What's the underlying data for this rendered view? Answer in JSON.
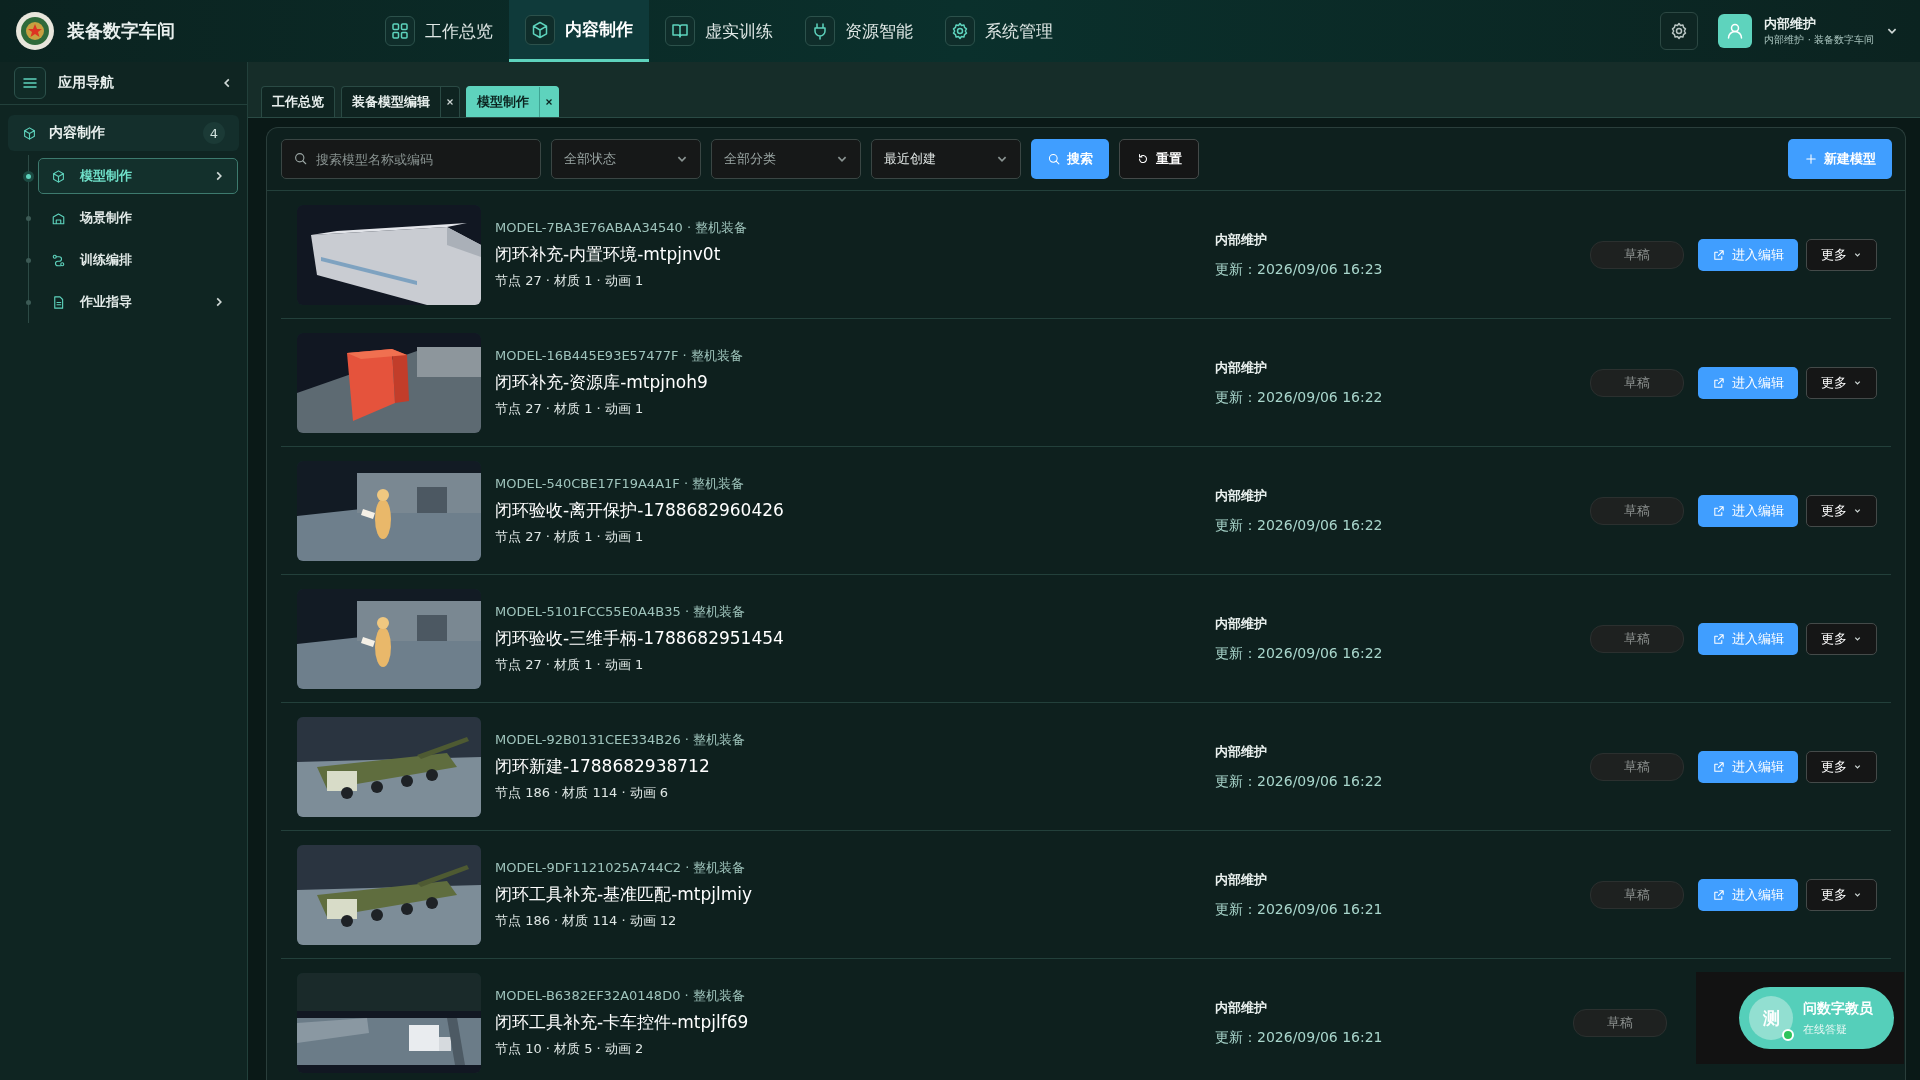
{
  "app": {
    "title": "装备数字车间"
  },
  "top_nav": [
    {
      "label": "工作总览",
      "selected": false
    },
    {
      "label": "内容制作",
      "selected": true
    },
    {
      "label": "虚实训练",
      "selected": false
    },
    {
      "label": "资源智能",
      "selected": false
    },
    {
      "label": "系统管理",
      "selected": false
    }
  ],
  "user": {
    "name": "内部维护",
    "subtitle": "内部维护 · 装备数字车间"
  },
  "sidebar": {
    "title": "应用导航",
    "group": {
      "label": "内容制作",
      "count": "4",
      "items": [
        {
          "label": "模型制作",
          "selected": true,
          "expandable": true
        },
        {
          "label": "场景制作",
          "selected": false,
          "expandable": false
        },
        {
          "label": "训练编排",
          "selected": false,
          "expandable": false
        },
        {
          "label": "作业指导",
          "selected": false,
          "expandable": true
        }
      ]
    }
  },
  "tabs": [
    {
      "label": "工作总览",
      "selected": false,
      "closable": false
    },
    {
      "label": "装备模型编辑",
      "selected": false,
      "closable": true
    },
    {
      "label": "模型制作",
      "selected": true,
      "closable": true
    }
  ],
  "filters": {
    "search": {
      "placeholder": "搜索模型名称或编码"
    },
    "selects": [
      "全部状态",
      "全部分类",
      "最近创建"
    ],
    "search_button": "搜索",
    "reset_button": "重置",
    "new_button": "新建模型"
  },
  "models": [
    {
      "code": "MODEL-7BA3E76ABAA34540 · 整机装备",
      "name": "闭环补充-内置环境-mtpjnv0t",
      "stats": "节点 27 · 材质 1 · 动画 1",
      "owner": "内部维护",
      "updated": "更新：2026/09/06 16:23",
      "status": "草稿",
      "edit_label": "进入编辑",
      "more_label": "更多"
    },
    {
      "code": "MODEL-16B445E93E57477F · 整机装备",
      "name": "闭环补充-资源库-mtpjnoh9",
      "stats": "节点 27 · 材质 1 · 动画 1",
      "owner": "内部维护",
      "updated": "更新：2026/09/06 16:22",
      "status": "草稿",
      "edit_label": "进入编辑",
      "more_label": "更多"
    },
    {
      "code": "MODEL-540CBE17F19A4A1F · 整机装备",
      "name": "闭环验收-离开保护-1788682960426",
      "stats": "节点 27 · 材质 1 · 动画 1",
      "owner": "内部维护",
      "updated": "更新：2026/09/06 16:22",
      "status": "草稿",
      "edit_label": "进入编辑",
      "more_label": "更多"
    },
    {
      "code": "MODEL-5101FCC55E0A4B35 · 整机装备",
      "name": "闭环验收-三维手柄-1788682951454",
      "stats": "节点 27 · 材质 1 · 动画 1",
      "owner": "内部维护",
      "updated": "更新：2026/09/06 16:22",
      "status": "草稿",
      "edit_label": "进入编辑",
      "more_label": "更多"
    },
    {
      "code": "MODEL-92B0131CEE334B26 · 整机装备",
      "name": "闭环新建-1788682938712",
      "stats": "节点 186 · 材质 114 · 动画 6",
      "owner": "内部维护",
      "updated": "更新：2026/09/06 16:22",
      "status": "草稿",
      "edit_label": "进入编辑",
      "more_label": "更多"
    },
    {
      "code": "MODEL-9DF1121025A744C2 · 整机装备",
      "name": "闭环工具补充-基准匹配-mtpjlmiy",
      "stats": "节点 186 · 材质 114 · 动画 12",
      "owner": "内部维护",
      "updated": "更新：2026/09/06 16:21",
      "status": "草稿",
      "edit_label": "进入编辑",
      "more_label": "更多"
    },
    {
      "code": "MODEL-B6382EF32A0148D0 · 整机装备",
      "name": "闭环工具补充-卡车控件-mtpjlf69",
      "stats": "节点 10 · 材质 5 · 动画 2",
      "owner": "内部维护",
      "updated": "更新：2026/09/06 16:21",
      "status": "草稿"
    }
  ],
  "assistant": {
    "avatar": "测",
    "title": "问数字教员",
    "subtitle": "在线答疑",
    "online": true
  }
}
